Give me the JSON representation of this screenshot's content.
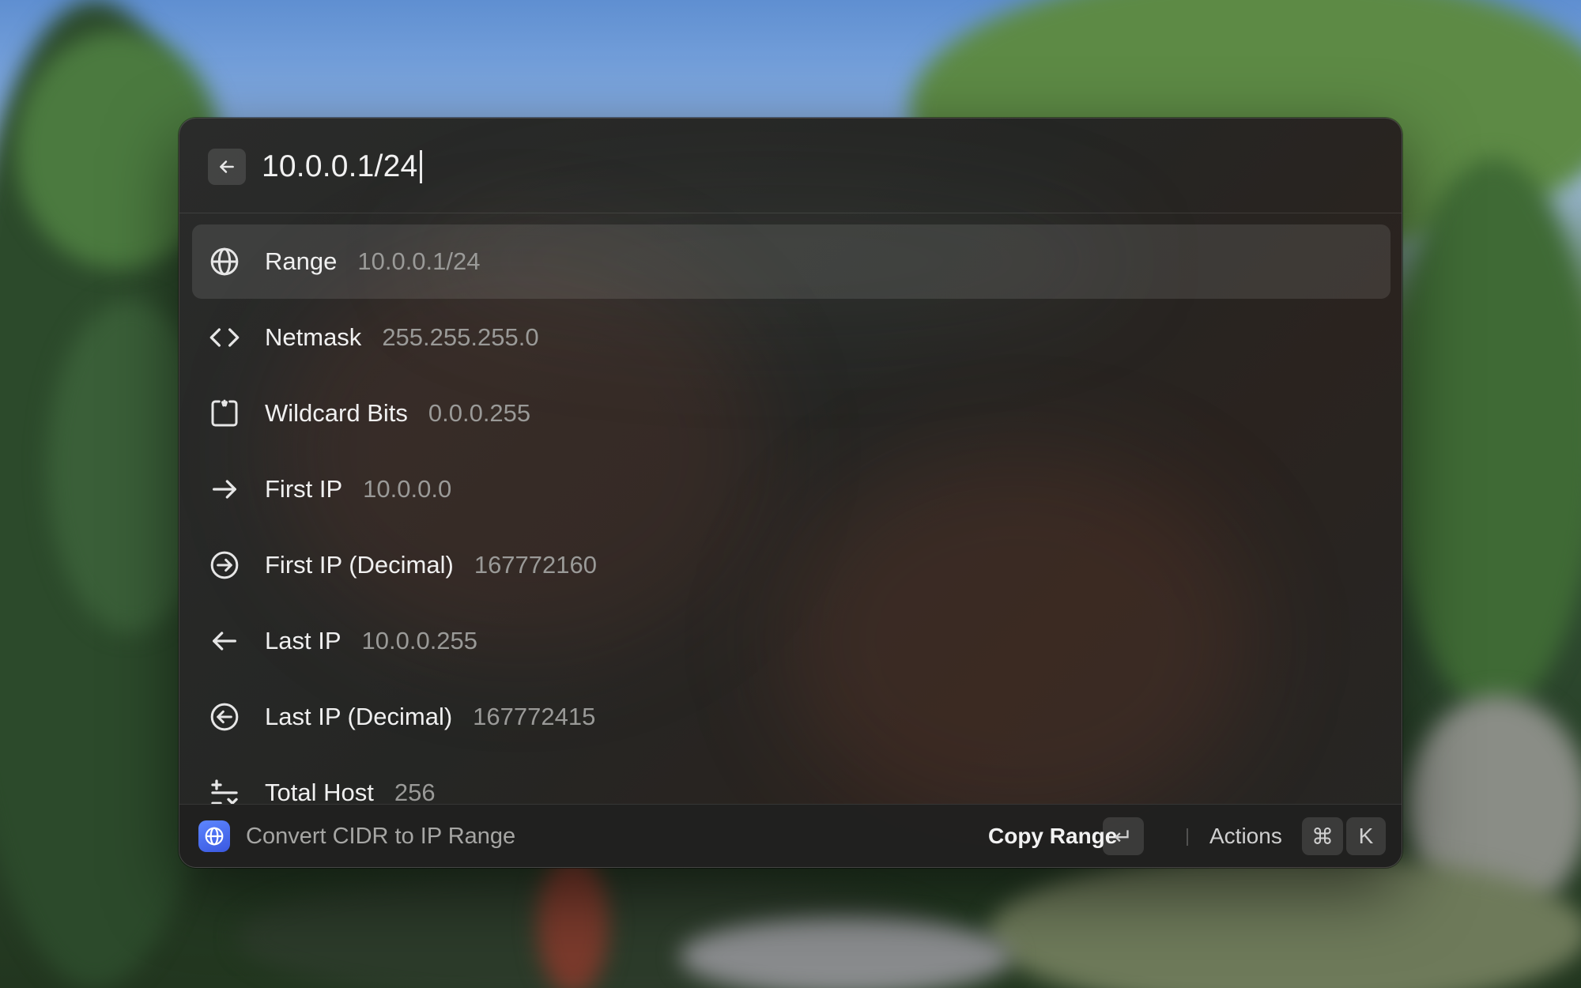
{
  "search": {
    "query": "10.0.0.1/24",
    "back_icon": "arrow-left-icon"
  },
  "results": [
    {
      "icon": "globe-icon",
      "title": "Range",
      "value": "10.0.0.1/24",
      "selected": true
    },
    {
      "icon": "code-brackets-icon",
      "title": "Netmask",
      "value": "255.255.255.0",
      "selected": false
    },
    {
      "icon": "wildcard-frame-icon",
      "title": "Wildcard Bits",
      "value": "0.0.0.255",
      "selected": false
    },
    {
      "icon": "arrow-right-icon",
      "title": "First IP",
      "value": "10.0.0.0",
      "selected": false
    },
    {
      "icon": "arrow-right-circle-icon",
      "title": "First IP (Decimal)",
      "value": "167772160",
      "selected": false
    },
    {
      "icon": "arrow-left-icon",
      "title": "Last IP",
      "value": "10.0.0.255",
      "selected": false
    },
    {
      "icon": "arrow-left-circle-icon",
      "title": "Last IP (Decimal)",
      "value": "167772415",
      "selected": false
    },
    {
      "icon": "plus-minus-icon",
      "title": "Total Host",
      "value": "256",
      "selected": false
    }
  ],
  "footer": {
    "command_icon": "globe-icon",
    "command_title": "Convert CIDR to IP Range",
    "primary_action": "Copy Range",
    "primary_key": "↵",
    "actions_label": "Actions",
    "actions_keys": [
      "⌘",
      "K"
    ]
  }
}
